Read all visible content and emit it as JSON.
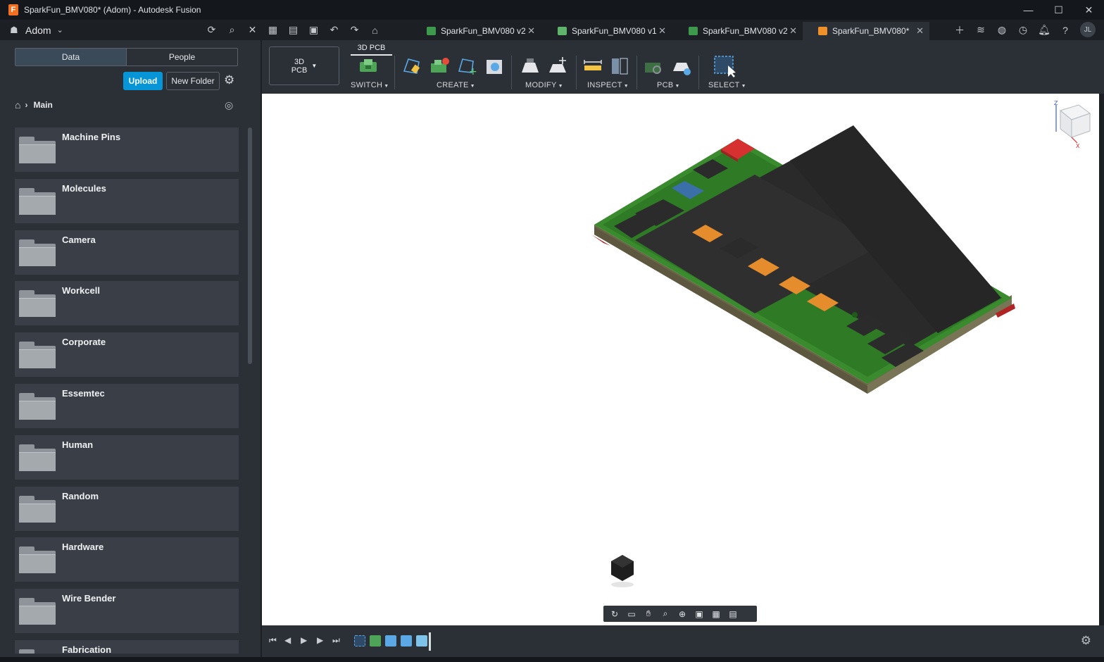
{
  "window": {
    "title": "SparkFun_BMV080* (Adom) - Autodesk Fusion",
    "controls": {
      "minimize": "—",
      "maximize": "☐",
      "close": "✕"
    }
  },
  "team": {
    "name": "Adom"
  },
  "tabs": [
    {
      "label": "SparkFun_BMV080 v2",
      "icon_color": "#3d9a4c",
      "active": false
    },
    {
      "label": "SparkFun_BMV080 v1",
      "icon_color": "#5fb36a",
      "active": false
    },
    {
      "label": "SparkFun_BMV080 v2",
      "icon_color": "#3d9a4c",
      "active": false
    },
    {
      "label": "SparkFun_BMV080*",
      "icon_color": "#f0902a",
      "active": true
    }
  ],
  "user": {
    "initials": "JL"
  },
  "panel": {
    "segments": {
      "data": "Data",
      "people": "People"
    },
    "upload": "Upload",
    "new_folder": "New Folder",
    "breadcrumb": "Main",
    "folders": [
      "Machine Pins",
      "Molecules",
      "Camera",
      "Workcell",
      "Corporate",
      "Essemtec",
      "Human",
      "Random",
      "Hardware",
      "Wire Bender",
      "Fabrication"
    ]
  },
  "toolbar": {
    "workspace_line1": "3D",
    "workspace_line2": "PCB",
    "active_tab": "3D PCB",
    "groups": {
      "switch": "SWITCH",
      "create": "CREATE",
      "modify": "MODIFY",
      "inspect": "INSPECT",
      "pcb": "PCB",
      "select": "SELECT"
    }
  },
  "colors": {
    "accent": "#0696d7",
    "board_green": "#3a8a2e",
    "component_orange": "#e58d2d",
    "component_red": "#d63031",
    "component_blue": "#3a6fa8"
  }
}
